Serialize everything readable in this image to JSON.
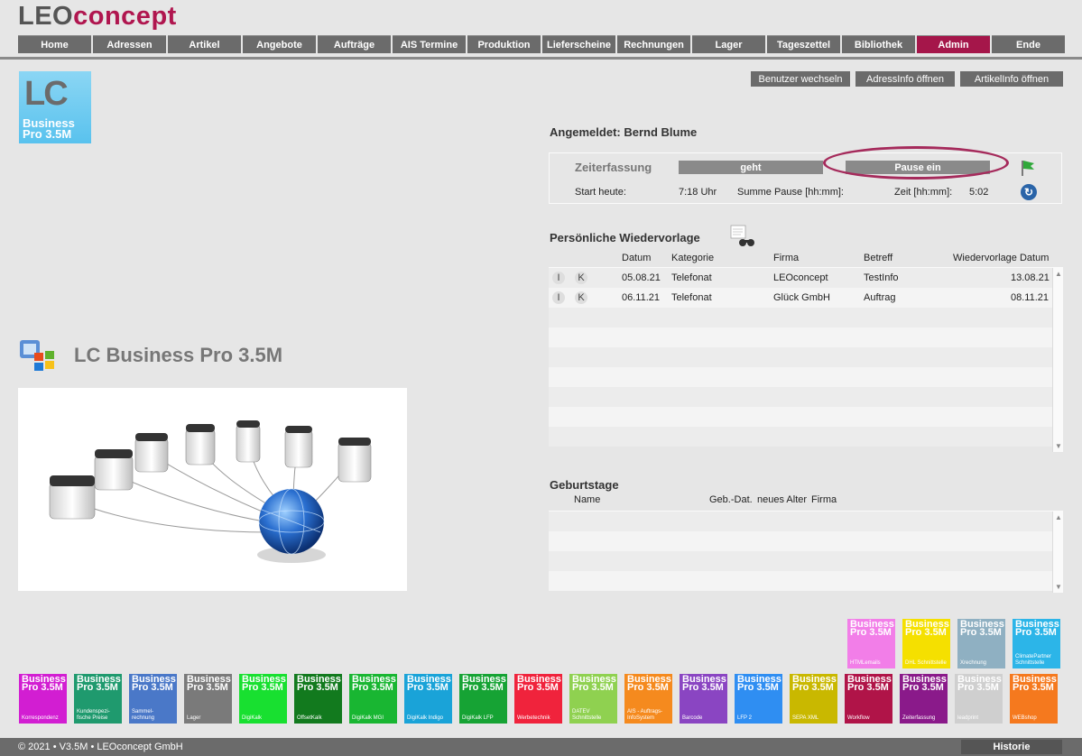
{
  "brand": {
    "leo": "LEO",
    "concept": "concept"
  },
  "nav": [
    "Home",
    "Adressen",
    "Artikel",
    "Angebote",
    "Aufträge",
    "AIS Termine",
    "Produktion",
    "Lieferscheine",
    "Rechnungen",
    "Lager",
    "Tageszettel",
    "Bibliothek",
    "Admin",
    "Ende"
  ],
  "nav_active": "Admin",
  "top_actions": [
    "Benutzer wechseln",
    "AdressInfo öffnen",
    "ArtikelInfo öffnen"
  ],
  "app_icon": {
    "lc": "LC",
    "line1": "Business",
    "line2": "Pro 3.5M"
  },
  "product_title": "LC Business Pro 3.5M",
  "logged_in": "Angemeldet: Bernd Blume",
  "time": {
    "label": "Zeiterfassung",
    "goes_button": "geht",
    "pause_button": "Pause ein",
    "start_label": "Start heute:",
    "start_value": "7:18 Uhr",
    "pause_sum_label": "Summe Pause [hh:mm]:",
    "time_label": "Zeit [hh:mm]:",
    "time_value": "5:02"
  },
  "wiedervorlage": {
    "title": "Persönliche Wiedervorlage",
    "headers": {
      "datum": "Datum",
      "kategorie": "Kategorie",
      "firma": "Firma",
      "betreff": "Betreff",
      "wv": "Wiedervorlage Datum"
    },
    "rows": [
      {
        "i": "I",
        "k": "K",
        "datum": "05.08.21",
        "kategorie": "Telefonat",
        "firma": "LEOconcept",
        "betreff": "TestInfo",
        "wv": "13.08.21"
      },
      {
        "i": "I",
        "k": "K",
        "datum": "06.11.21",
        "kategorie": "Telefonat",
        "firma": "Glück GmbH",
        "betreff": "Auftrag",
        "wv": "08.11.21"
      }
    ]
  },
  "geburtstage": {
    "title": "Geburtstage",
    "headers": {
      "name": "Name",
      "gebdat": "Geb.-Dat.",
      "alter": "neues Alter",
      "firma": "Firma"
    }
  },
  "tile_line1": "Business",
  "tile_line2": "Pro 3.5M",
  "tiles_top": [
    {
      "label": "HTMLemails",
      "color": "#f27ee8"
    },
    {
      "label": "DHL Schnittstelle",
      "color": "#f5e000"
    },
    {
      "label": "Xrechnung",
      "color": "#8fb0c2"
    },
    {
      "label": "ClimatePartner Schnittstelle",
      "color": "#2cb5e8"
    }
  ],
  "tiles_bottom": [
    {
      "label": "Korrespondenz",
      "color": "#d21ed2"
    },
    {
      "label": "Kundenspezi- fische Preise",
      "color": "#1f9a6e"
    },
    {
      "label": "Sammel- rechnung",
      "color": "#4a78c8"
    },
    {
      "label": "Lager",
      "color": "#7a7a7a"
    },
    {
      "label": "DigiKalk",
      "color": "#18e030"
    },
    {
      "label": "OffsetKalk",
      "color": "#127a1e"
    },
    {
      "label": "DigiKalk MGI",
      "color": "#19b632"
    },
    {
      "label": "DigiKalk Indigo",
      "color": "#1aa3d8"
    },
    {
      "label": "DigiKalk LFP",
      "color": "#16a334"
    },
    {
      "label": "Werbetechnik",
      "color": "#f0233c"
    },
    {
      "label": "DATEV Schnittstelle",
      "color": "#8fd150"
    },
    {
      "label": "AIS - Auftrags- InfoSystem",
      "color": "#f58a1e"
    },
    {
      "label": "Barcode",
      "color": "#8a45c2"
    },
    {
      "label": "LFP 2",
      "color": "#2f8ef2"
    },
    {
      "label": "SEPA XML",
      "color": "#c9b800"
    },
    {
      "label": "Workflow",
      "color": "#b01448"
    },
    {
      "label": "Zeiterfassung",
      "color": "#8a1a8a"
    },
    {
      "label": "leadprint",
      "color": "#cfcfcf"
    },
    {
      "label": "WEBshop",
      "color": "#f5791e"
    }
  ],
  "footer": {
    "copyright": "© 2021 • V3.5M • LEOconcept GmbH",
    "history": "Historie"
  }
}
